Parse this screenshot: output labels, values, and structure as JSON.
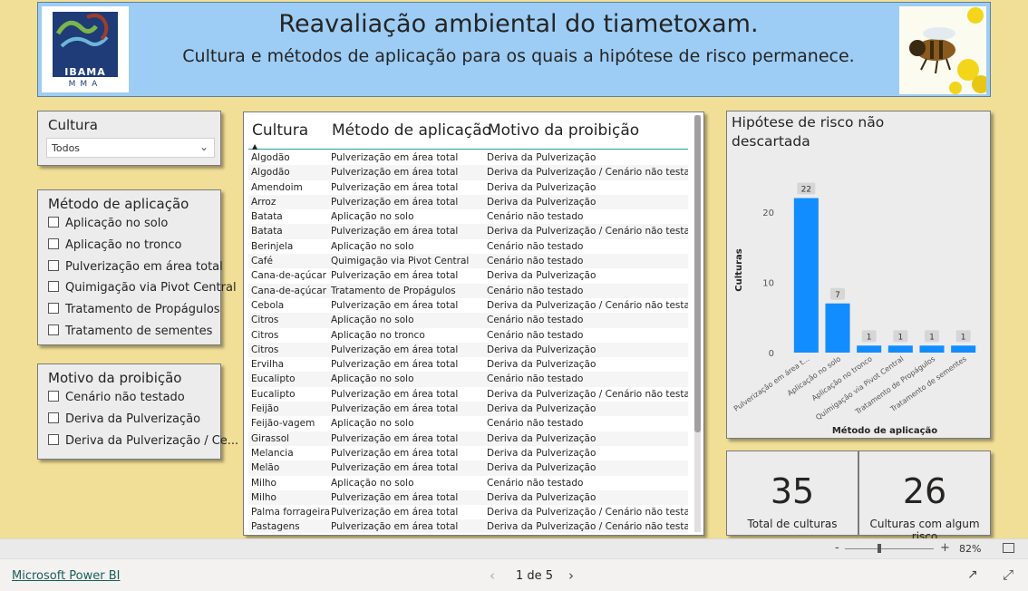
{
  "header": {
    "title": "Reavaliação ambiental do tiametoxam.",
    "subtitle": "Cultura e métodos de aplicação para os quais a hipótese de risco permanece.",
    "logo_text": "IBAMA",
    "logo_subtext": "MMA"
  },
  "slicer_cultura": {
    "title": "Cultura",
    "selected": "Todos"
  },
  "slicer_metodo": {
    "title": "Método de aplicação",
    "options": [
      "Aplicação no solo",
      "Aplicação no tronco",
      "Pulverização em área total",
      "Quimigação via Pivot Central",
      "Tratamento de Propágulos",
      "Tratamento de sementes"
    ]
  },
  "slicer_motivo": {
    "title": "Motivo da proibição",
    "options": [
      "Cenário não testado",
      "Deriva da Pulverização",
      "Deriva da Pulverização / Ce..."
    ]
  },
  "table": {
    "columns": [
      "Cultura",
      "Método de aplicação",
      "Motivo da proibição"
    ],
    "rows": [
      [
        "Algodão",
        "Pulverização em área total",
        "Deriva da Pulverização"
      ],
      [
        "Algodão",
        "Pulverização em área total",
        "Deriva da Pulverização / Cenário não testado"
      ],
      [
        "Amendoim",
        "Pulverização em área total",
        "Deriva da Pulverização"
      ],
      [
        "Arroz",
        "Pulverização em área total",
        "Deriva da Pulverização"
      ],
      [
        "Batata",
        "Aplicação no solo",
        "Cenário não testado"
      ],
      [
        "Batata",
        "Pulverização em área total",
        "Deriva da Pulverização / Cenário não testado"
      ],
      [
        "Berinjela",
        "Aplicação no solo",
        "Cenário não testado"
      ],
      [
        "Café",
        "Quimigação via Pivot Central",
        "Cenário não testado"
      ],
      [
        "Cana-de-açúcar",
        "Pulverização em área total",
        "Deriva da Pulverização"
      ],
      [
        "Cana-de-açúcar",
        "Tratamento de Propágulos",
        "Cenário não testado"
      ],
      [
        "Cebola",
        "Pulverização em área total",
        "Deriva da Pulverização / Cenário não testado"
      ],
      [
        "Citros",
        "Aplicação no solo",
        "Cenário não testado"
      ],
      [
        "Citros",
        "Aplicação no tronco",
        "Cenário não testado"
      ],
      [
        "Citros",
        "Pulverização em área total",
        "Deriva da Pulverização"
      ],
      [
        "Ervilha",
        "Pulverização em área total",
        "Deriva da Pulverização"
      ],
      [
        "Eucalipto",
        "Aplicação no solo",
        "Cenário não testado"
      ],
      [
        "Eucalipto",
        "Pulverização em área total",
        "Deriva da Pulverização / Cenário não testado"
      ],
      [
        "Feijão",
        "Pulverização em área total",
        "Deriva da Pulverização"
      ],
      [
        "Feijão-vagem",
        "Aplicação no solo",
        "Cenário não testado"
      ],
      [
        "Girassol",
        "Pulverização em área total",
        "Deriva da Pulverização"
      ],
      [
        "Melancia",
        "Pulverização em área total",
        "Deriva da Pulverização"
      ],
      [
        "Melão",
        "Pulverização em área total",
        "Deriva da Pulverização"
      ],
      [
        "Milho",
        "Aplicação no solo",
        "Cenário não testado"
      ],
      [
        "Milho",
        "Pulverização em área total",
        "Deriva da Pulverização"
      ],
      [
        "Palma forrageira",
        "Pulverização em área total",
        "Deriva da Pulverização / Cenário não testado"
      ],
      [
        "Pastagens",
        "Pulverização em área total",
        "Deriva da Pulverização / Cenário não testado"
      ]
    ]
  },
  "chart_data": {
    "type": "bar",
    "title": "Hipótese de risco não descartada",
    "xlabel": "Método de aplicação",
    "ylabel": "Culturas",
    "categories": [
      "Pulverização em área t...",
      "Aplicação no solo",
      "Aplicação no tronco",
      "Quimigação via Pivot Central",
      "Tratamento de Propágulos",
      "Tratamento de sementes"
    ],
    "values": [
      22,
      7,
      1,
      1,
      1,
      1
    ],
    "yticks": [
      0,
      10,
      20
    ],
    "ylim": [
      0,
      24
    ],
    "bar_color": "#118dff",
    "grid": false
  },
  "kpis": [
    {
      "value": "35",
      "label": "Total de culturas"
    },
    {
      "value": "26",
      "label": "Culturas com algum risco"
    }
  ],
  "zoom": {
    "minus": "-",
    "plus": "+",
    "level": "82%"
  },
  "footer": {
    "brand": "Microsoft Power BI",
    "page": "1 de 5"
  }
}
